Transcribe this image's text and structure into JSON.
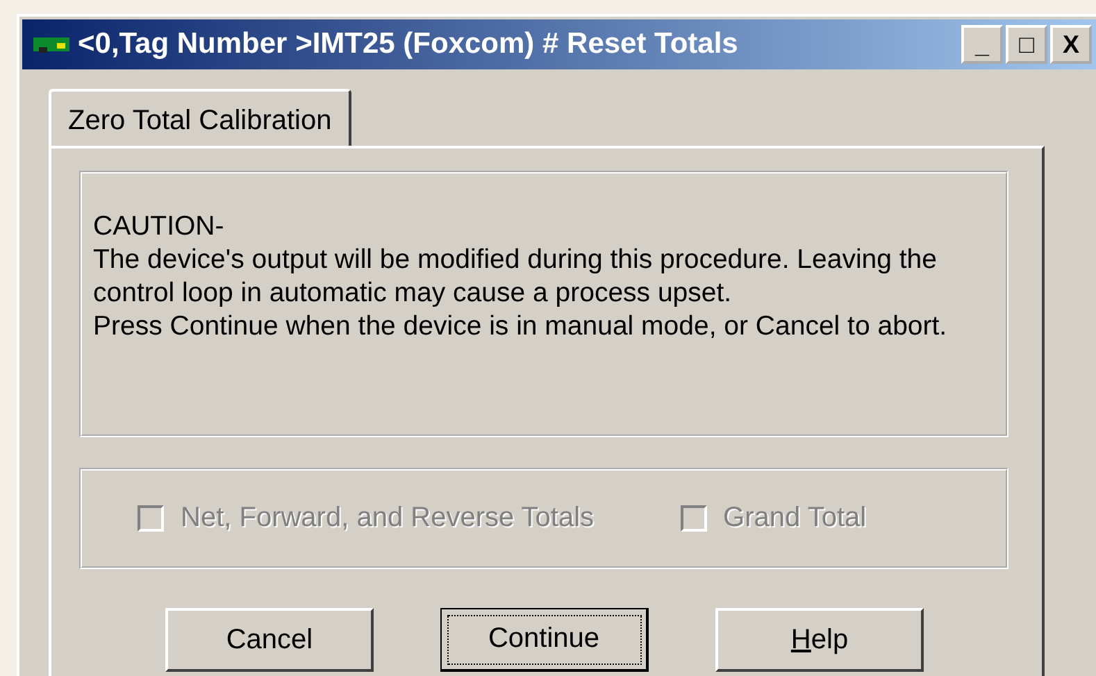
{
  "window": {
    "title": "<0,Tag Number  >IMT25 (Foxcom) # Reset Totals",
    "controls": [
      "_",
      "□",
      "X"
    ]
  },
  "tabs": [
    {
      "label": "Zero Total Calibration",
      "selected": true
    }
  ],
  "caution": {
    "lines": [
      "CAUTION-",
      "The device's output will be modified during this procedure. Leaving the control loop in automatic may cause a process upset.",
      "Press Continue when the device is in manual mode, or Cancel to abort."
    ]
  },
  "options": [
    {
      "label": "Net, Forward, and Reverse Totals",
      "checked": false,
      "disabled": true
    },
    {
      "label": "Grand Total",
      "checked": false,
      "disabled": true
    }
  ],
  "buttons": [
    {
      "label": "Cancel",
      "focused": false,
      "underline_first": false
    },
    {
      "label": "Continue",
      "focused": true,
      "underline_first": false
    },
    {
      "label": "Help",
      "focused": false,
      "underline_first": true
    }
  ]
}
